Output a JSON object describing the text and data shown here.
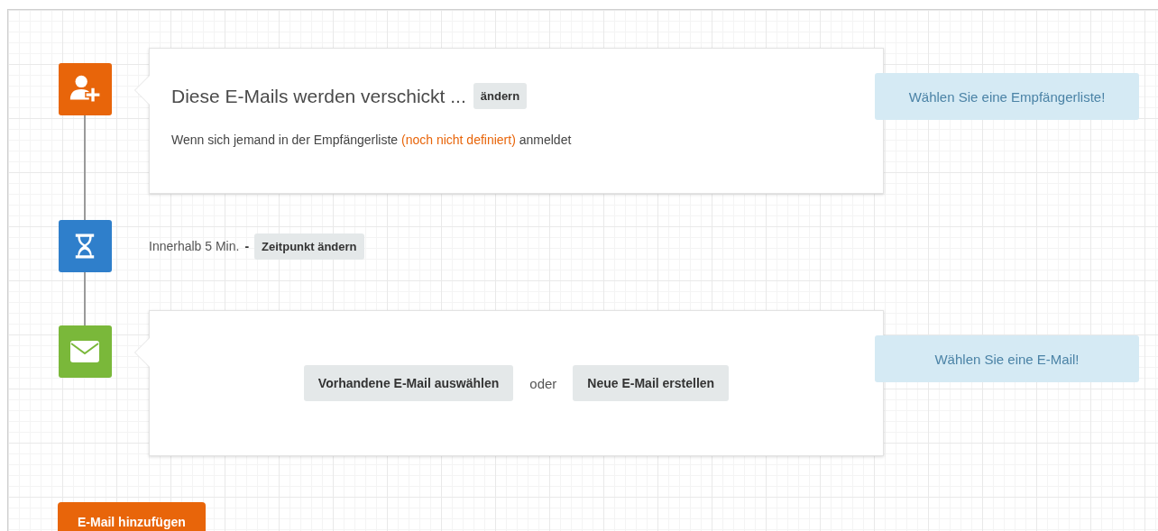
{
  "steps": [
    {
      "kind": "trigger",
      "title": "Diese E-Mails werden verschickt ...",
      "edit_button": "ändern",
      "description_before": "Wenn sich jemand in der Empfängerliste",
      "description_highlight": "(noch nicht definiert)",
      "description_after": "anmeldet",
      "hint": "Wählen Sie eine Empfängerliste!"
    },
    {
      "kind": "delay",
      "text": "Innerhalb 5 Min.",
      "separator": "-",
      "button": "Zeitpunkt ändern"
    },
    {
      "kind": "email",
      "buttons": [
        "Vorhandene E-Mail auswählen",
        "Neue E-Mail erstellen"
      ],
      "separator": "oder",
      "hint": "Wählen Sie eine E-Mail!"
    }
  ],
  "add_button": "E-Mail hinzufügen"
}
